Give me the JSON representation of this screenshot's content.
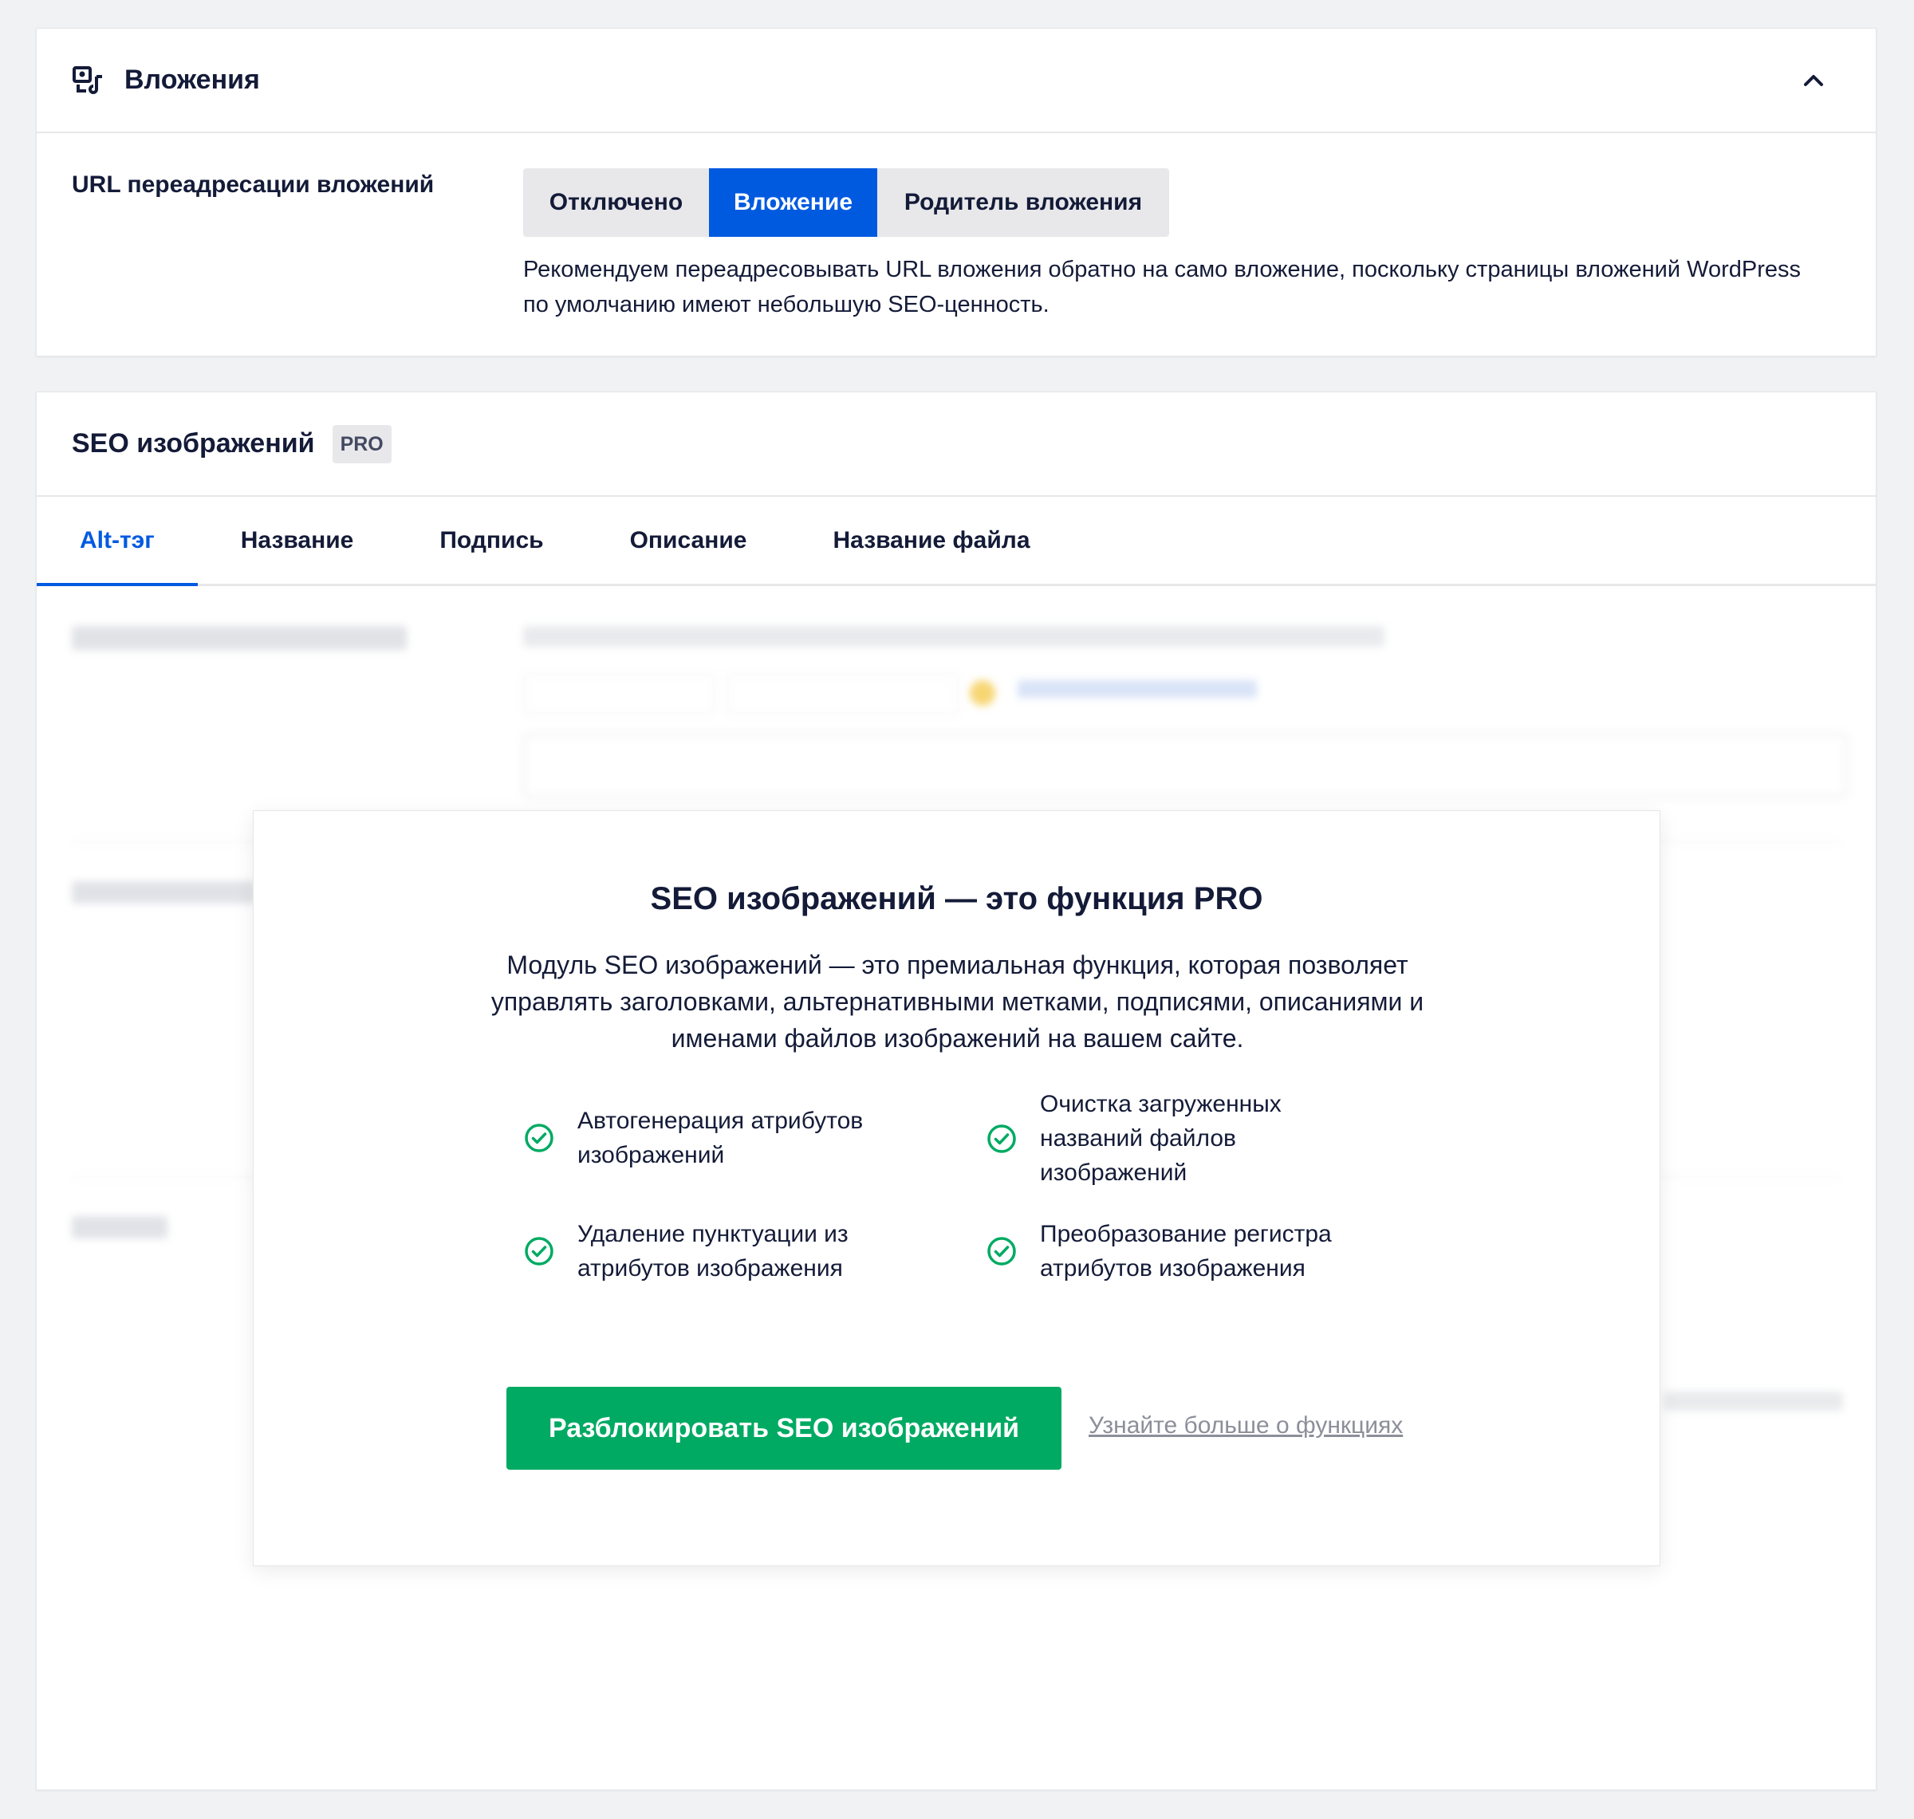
{
  "attachments": {
    "title": "Вложения",
    "header_icon": "attachment-icon",
    "collapse_icon": "chevron-up-icon",
    "redirect_label": "URL переадресации вложений",
    "options": [
      "Отключено",
      "Вложение",
      "Родитель вложения"
    ],
    "selected_option": "Вложение",
    "help_text": "Рекомендуем переадресовывать URL вложения обратно на само вложение, поскольку страницы вложений WordPress по умолчанию имеют небольшую SEO-ценность."
  },
  "image_seo": {
    "title": "SEO изображений",
    "badge": "PRO",
    "tabs": [
      "Alt-тэг",
      "Название",
      "Подпись",
      "Описание",
      "Название файла"
    ],
    "active_tab": "Alt-тэг"
  },
  "modal": {
    "title": "SEO изображений — это функция PRO",
    "description": "Модуль SEO изображений — это премиальная функция, которая позволяет управлять заголовками, альтернативными метками, подписями, описаниями и именами файлов изображений на вашем сайте.",
    "features": [
      "Автогенерация атрибутов изображений",
      "Очистка загруженных названий файлов изображений",
      "Удаление пунктуации из атрибутов изображения",
      "Преобразование регистра атрибутов изображения"
    ],
    "feature_icon": "check-circle-icon",
    "unlock_button": "Разблокировать SEO изображений",
    "learn_more": "Узнайте больше о функциях"
  },
  "colors": {
    "accent_blue": "#005ae0",
    "success_green": "#00aa63",
    "text_dark": "#141b38",
    "page_bg": "#f1f2f4"
  }
}
